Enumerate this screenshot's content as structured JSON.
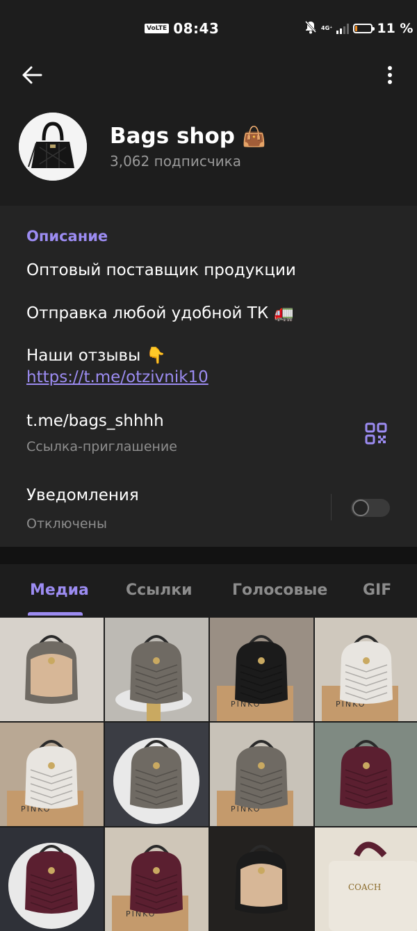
{
  "status_bar": {
    "volte": "VoLTE",
    "time": "08:43",
    "network": "4G⁺",
    "battery_percent": "11 %",
    "battery_level": 0.11
  },
  "channel": {
    "name": "Bags shop",
    "name_emoji": "👜",
    "subscribers": "3,062 подписчика"
  },
  "info": {
    "section_title": "Описание",
    "description": [
      {
        "text": "Оптовый поставщик продукции",
        "emoji": ""
      },
      {
        "text": "Отправка любой удобной ТК",
        "emoji": "🚛"
      },
      {
        "text": "Наши отзывы",
        "emoji": "👇"
      }
    ],
    "reviews_link": "https://t.me/otzivnik10",
    "invite_link": "t.me/bags_shhhh",
    "invite_label": "Ссылка-приглашение",
    "notifications_title": "Уведомления",
    "notifications_state": "Отключены",
    "notifications_enabled": false
  },
  "tabs": [
    {
      "label": "Медиа",
      "active": true
    },
    {
      "label": "Ссылки",
      "active": false
    },
    {
      "label": "Голосовые",
      "active": false
    },
    {
      "label": "GIF",
      "active": false
    }
  ],
  "media_colors": {
    "bag_grey": "#6f6a63",
    "bag_black": "#1b1b1b",
    "bag_white": "#e8e5e0",
    "bag_burgundy": "#5b1f30",
    "box_kraft": "#c49a6c",
    "accent": "#9c8cf2"
  }
}
